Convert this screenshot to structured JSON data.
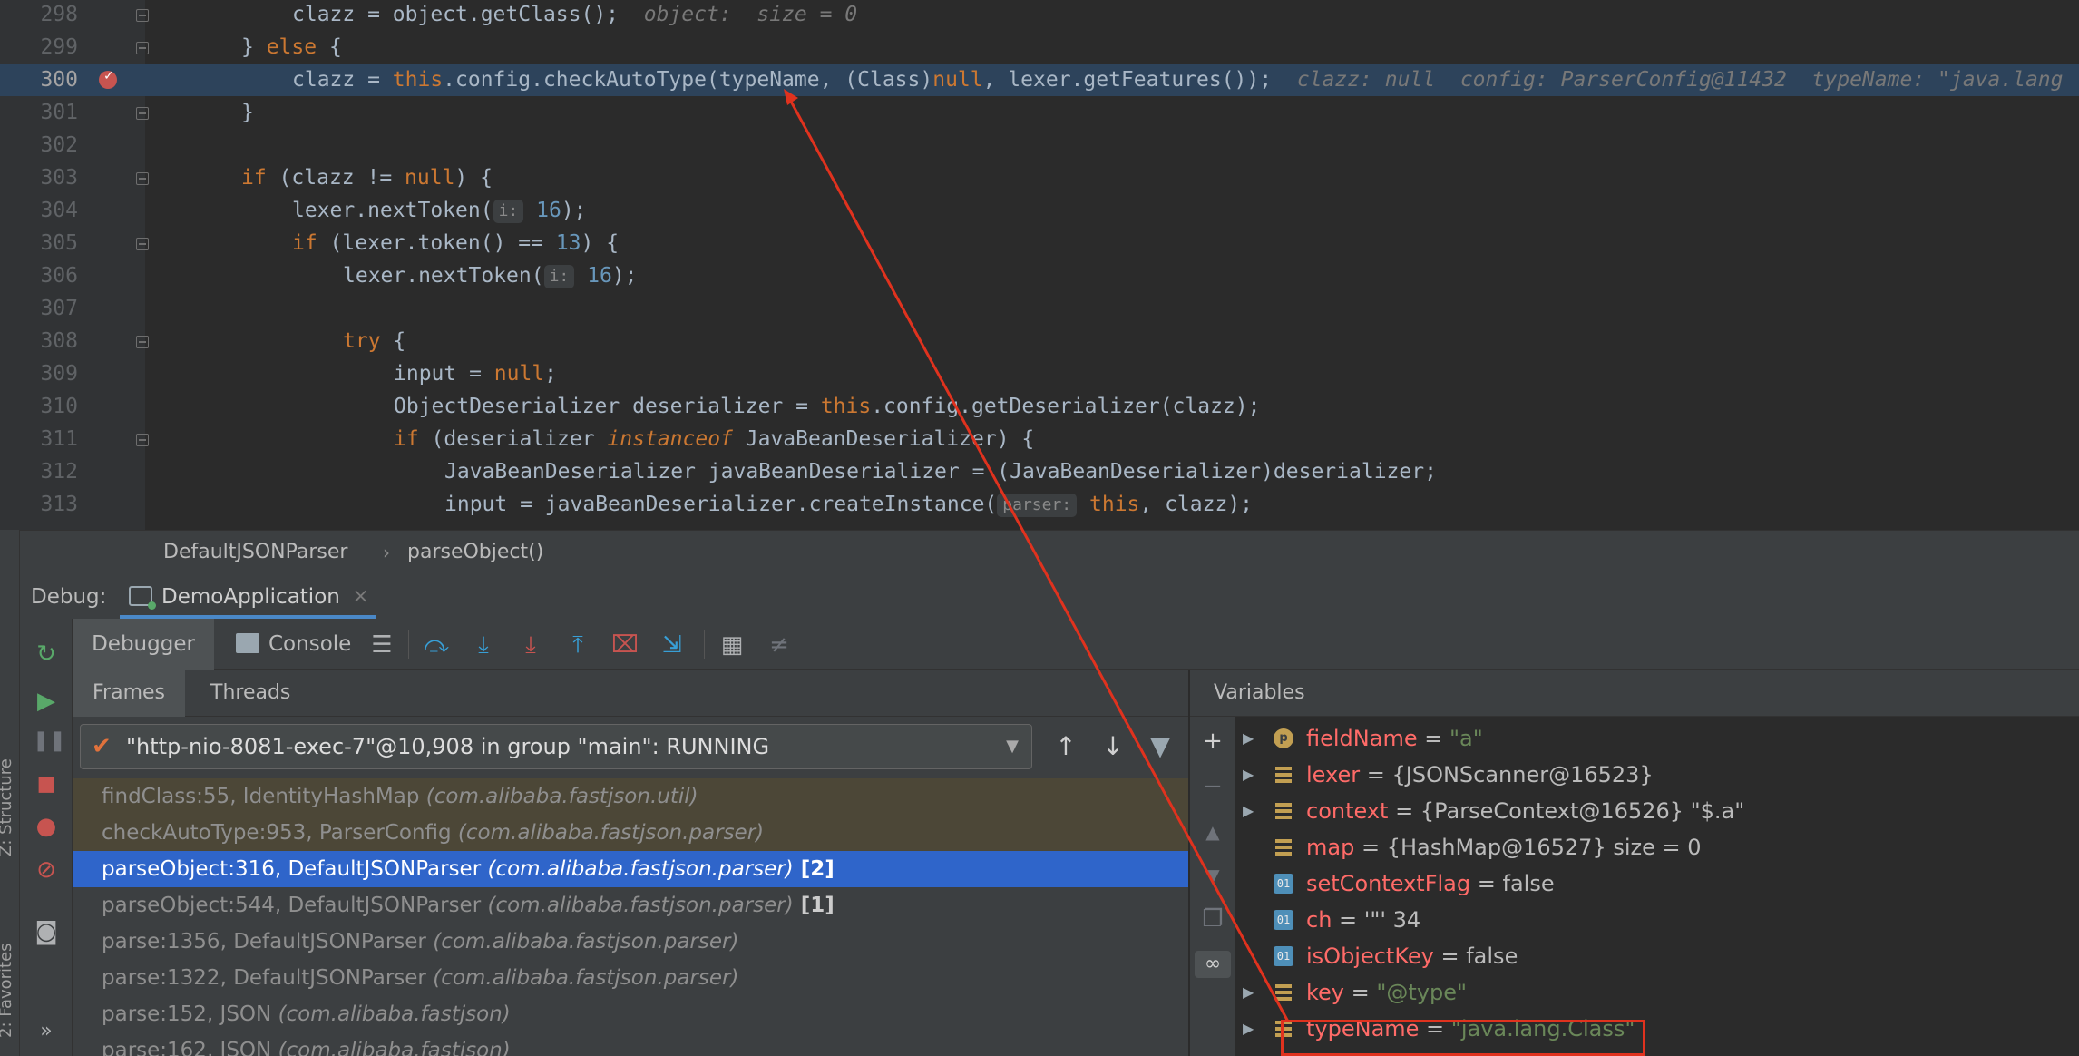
{
  "editor": {
    "lines": [
      {
        "num": "298"
      },
      {
        "num": "299"
      },
      {
        "num": "300"
      },
      {
        "num": "301"
      },
      {
        "num": "302"
      },
      {
        "num": "303"
      },
      {
        "num": "304"
      },
      {
        "num": "305"
      },
      {
        "num": "306"
      },
      {
        "num": "307"
      },
      {
        "num": "308"
      },
      {
        "num": "309"
      },
      {
        "num": "310"
      },
      {
        "num": "311"
      },
      {
        "num": "312"
      },
      {
        "num": "313"
      }
    ],
    "code": {
      "l298_a": "clazz = object.getClass();",
      "l298_hint": "object:  size = 0",
      "l299_a": "} ",
      "l299_kw": "else",
      "l299_b": " {",
      "l300_a": "clazz = ",
      "l300_kw1": "this",
      "l300_b": ".config.checkAutoType(typeName, (Class)",
      "l300_kw2": "null",
      "l300_c": ", lexer.getFeatures());",
      "l300_hint": "clazz: null  config: ParserConfig@11432  typeName: \"java.lang",
      "l301": "}",
      "l303_kw": "if",
      "l303_a": " (clazz != ",
      "l303_kw2": "null",
      "l303_b": ") {",
      "l304_a": "lexer.nextToken(",
      "l304_tag": "i:",
      "l304_num": "16",
      "l304_b": ");",
      "l305_kw": "if",
      "l305_a": " (lexer.token() == ",
      "l305_num": "13",
      "l305_b": ") {",
      "l306_a": "lexer.nextToken(",
      "l306_tag": "i:",
      "l306_num": "16",
      "l306_b": ");",
      "l308_kw": "try",
      "l308_a": " {",
      "l309_a": "input = ",
      "l309_kw": "null",
      "l309_b": ";",
      "l310_a": "ObjectDeserializer deserializer = ",
      "l310_kw": "this",
      "l310_b": ".config.getDeserializer(clazz);",
      "l311_kw": "if",
      "l311_a": " (deserializer ",
      "l311_kw2": "instanceof",
      "l311_b": " JavaBeanDeserializer) {",
      "l312_a": "JavaBeanDeserializer javaBeanDeserializer = (JavaBeanDeserializer)deserializer;",
      "l313_a": "input = javaBeanDeserializer.createInstance(",
      "l313_tag": "parser:",
      "l313_kw": "this",
      "l313_b": ", clazz);"
    }
  },
  "breadcrumb": {
    "class_name": "DefaultJSONParser",
    "sep": "›",
    "method": "parseObject()"
  },
  "debug": {
    "label": "Debug:",
    "run_tab": "DemoApplication",
    "close": "×",
    "left_strip": {
      "structure": "Z: Structure",
      "favorites": "2: Favorites"
    },
    "toolbar": {
      "debugger": "Debugger",
      "console": "Console"
    },
    "frames_tab": "Frames",
    "threads_tab": "Threads",
    "thread": "\"http-nio-8081-exec-7\"@10,908 in group \"main\": RUNNING",
    "frames": [
      {
        "loc": "findClass:55, IdentityHashMap ",
        "pkg": "(com.alibaba.fastjson.util)",
        "cnt": ""
      },
      {
        "loc": "checkAutoType:953, ParserConfig ",
        "pkg": "(com.alibaba.fastjson.parser)",
        "cnt": ""
      },
      {
        "loc": "parseObject:316, DefaultJSONParser ",
        "pkg": "(com.alibaba.fastjson.parser)",
        "cnt": " [2]"
      },
      {
        "loc": "parseObject:544, DefaultJSONParser ",
        "pkg": "(com.alibaba.fastjson.parser)",
        "cnt": " [1]"
      },
      {
        "loc": "parse:1356, DefaultJSONParser ",
        "pkg": "(com.alibaba.fastjson.parser)",
        "cnt": ""
      },
      {
        "loc": "parse:1322, DefaultJSONParser ",
        "pkg": "(com.alibaba.fastjson.parser)",
        "cnt": ""
      },
      {
        "loc": "parse:152, JSON ",
        "pkg": "(com.alibaba.fastjson)",
        "cnt": ""
      },
      {
        "loc": "parse:162, JSON ",
        "pkg": "(com.alibaba.fastjson)",
        "cnt": ""
      }
    ],
    "variables_header": "Variables",
    "variables": [
      {
        "name": "fieldName",
        "eq": " = ",
        "val": "\"a\""
      },
      {
        "name": "lexer",
        "eq": " = ",
        "val": "{JSONScanner@16523}"
      },
      {
        "name": "context",
        "eq": " = ",
        "val": "{ParseContext@16526} \"$.a\""
      },
      {
        "name": "map",
        "eq": " = ",
        "val": "{HashMap@16527}  size = 0"
      },
      {
        "name": "setContextFlag",
        "eq": " = ",
        "val": "false"
      },
      {
        "name": "ch",
        "eq": " = ",
        "val": "'\"' 34"
      },
      {
        "name": "isObjectKey",
        "eq": " = ",
        "val": "false"
      },
      {
        "name": "key",
        "eq": " = ",
        "val": "\"@type\""
      },
      {
        "name": "typeName",
        "eq": " = ",
        "val": "\"java.lang.Class\""
      }
    ]
  },
  "icons": {
    "breakpoint": "breakpoint-icon",
    "rerun": "rerun-icon",
    "resume": "resume-icon",
    "pause": "pause-icon",
    "stop": "stop-icon",
    "view-breakpoints": "view-breakpoints-icon",
    "mute-breakpoints": "mute-breakpoints-icon",
    "camera": "camera-icon"
  },
  "colors": {
    "keyword": "#cc7832",
    "number": "#6897bb",
    "string": "#6a8759",
    "var_name": "#ff6b68",
    "selection": "#2f65ca",
    "annotation": "#e0321e"
  }
}
